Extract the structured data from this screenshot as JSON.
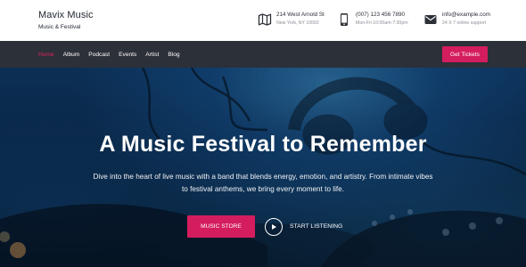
{
  "brand": {
    "title": "Mavix Music",
    "subtitle": "Music & Festival"
  },
  "contact": [
    {
      "icon": "map-icon",
      "line1": "214 West Arnold St",
      "line2": "New York, NY 10002"
    },
    {
      "icon": "phone-icon",
      "line1": "(007) 123 456 7890",
      "line2": "Mon-Fri 10:00am-7:30pm"
    },
    {
      "icon": "mail-icon",
      "line1": "info@example.com",
      "line2": "24 X 7 online support"
    }
  ],
  "nav": {
    "items": [
      "Home",
      "Album",
      "Podcast",
      "Events",
      "Artist",
      "Blog"
    ],
    "active": "Home",
    "cta": "Get Tickets"
  },
  "hero": {
    "title": "A Music Festival to Remember",
    "text": "Dive into the heart of live music with a band that blends energy, emotion, and artistry. From intimate vibes to festival anthems, we bring every moment to life.",
    "primary_button": "MUSIC STORE",
    "secondary_button": "START LISTENING"
  },
  "colors": {
    "accent": "#d41d5e",
    "nav_bg": "#2c3038",
    "topbar_bg": "#ffffff"
  }
}
